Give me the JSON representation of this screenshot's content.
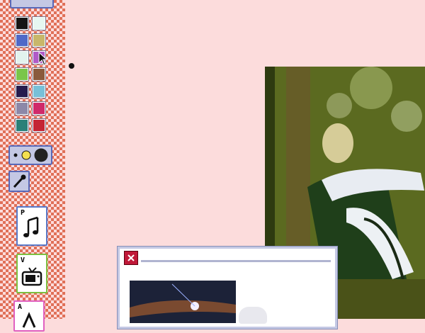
{
  "toolbar": {
    "palette": [
      {
        "color": "#151515"
      },
      {
        "color": "#e6f7f1"
      },
      {
        "color": "#4f69c8"
      },
      {
        "color": "#c8b76a"
      },
      {
        "color": "#e2f3ee"
      },
      {
        "color": "#b05ac8"
      },
      {
        "color": "#7ac64a"
      },
      {
        "color": "#8a5a3c"
      },
      {
        "color": "#261c4e"
      },
      {
        "color": "#78c0d8"
      },
      {
        "color": "#8c88a8"
      },
      {
        "color": "#d02a6a"
      },
      {
        "color": "#2a8078"
      },
      {
        "color": "#c42434"
      }
    ],
    "documents": [
      {
        "letter": "P",
        "icon": "music-note-icon"
      },
      {
        "letter": "V",
        "icon": "tv-icon"
      },
      {
        "letter": "A",
        "icon": "ai-icon"
      }
    ]
  },
  "colors": {
    "background": "#fcdcdc",
    "checker": "#e07058",
    "button_face": "#c4c8e4",
    "button_border": "#5868b8",
    "close_button": "#c01838"
  }
}
